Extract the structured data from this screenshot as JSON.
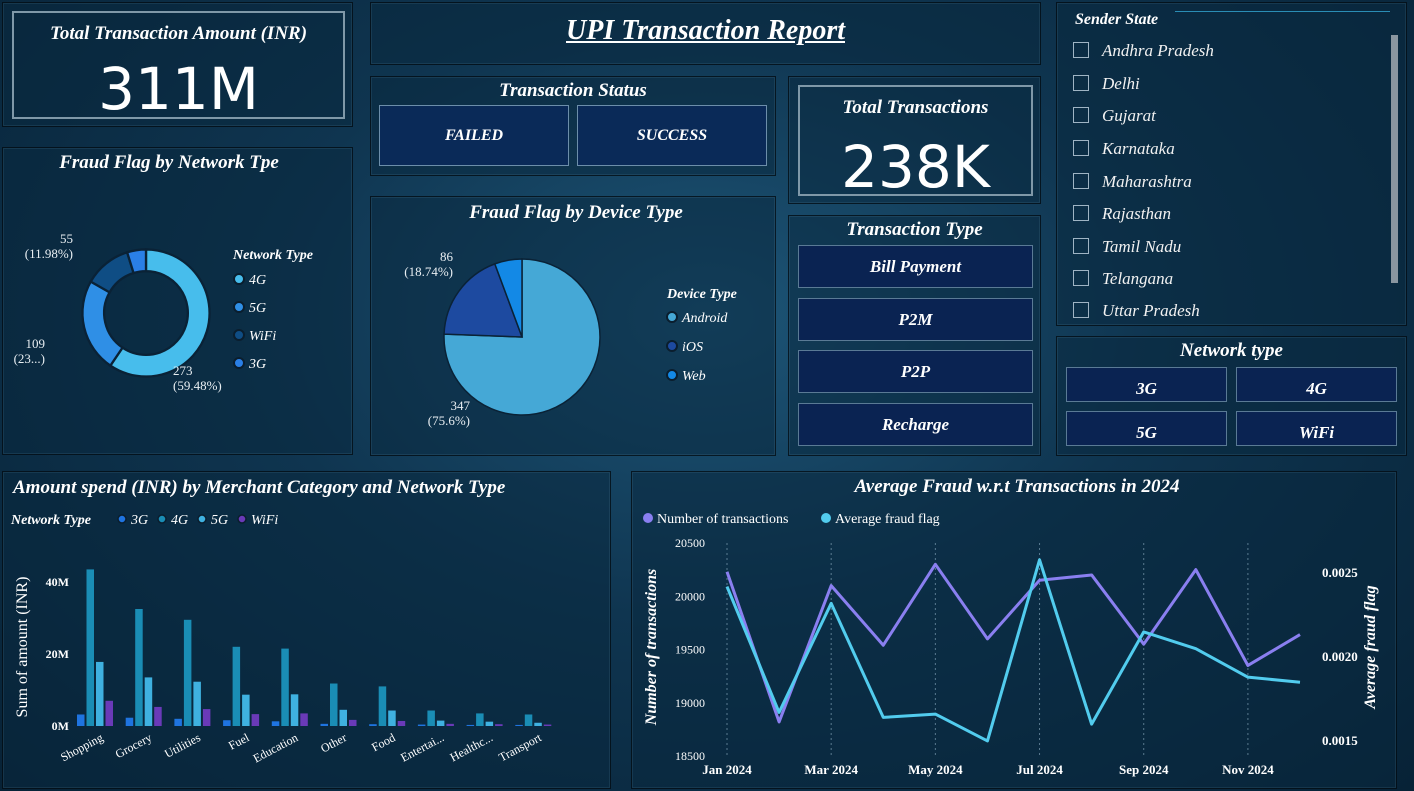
{
  "kpi_amount": {
    "title": "Total Transaction Amount (INR)",
    "value": "311M"
  },
  "report_title": "UPI Transaction Report",
  "status": {
    "title": "Transaction Status",
    "buttons": [
      "FAILED",
      "SUCCESS"
    ]
  },
  "kpi_count": {
    "title": "Total Transactions",
    "value": "238K"
  },
  "sender_state": {
    "title": "Sender State",
    "items": [
      "Andhra Pradesh",
      "Delhi",
      "Gujarat",
      "Karnataka",
      "Maharashtra",
      "Rajasthan",
      "Tamil Nadu",
      "Telangana",
      "Uttar Pradesh"
    ]
  },
  "txn_type": {
    "title": "Transaction Type",
    "buttons": [
      "Bill Payment",
      "P2M",
      "P2P",
      "Recharge"
    ]
  },
  "network_slicer": {
    "title": "Network type",
    "buttons": [
      "3G",
      "4G",
      "5G",
      "WiFi"
    ]
  },
  "colors": {
    "g3": "#1f74e0",
    "g4": "#1a8db5",
    "g5": "#3fb1e0",
    "wifi": "#6a3ab8",
    "line_txn": "#8a7ff0",
    "line_fraud": "#52ccee"
  },
  "chart_data": [
    {
      "type": "pie",
      "variant": "donut",
      "title": "Fraud Flag by Network Tpe",
      "legend_title": "Network Type",
      "legend": [
        "4G",
        "5G",
        "WiFi",
        "3G"
      ],
      "slices": [
        {
          "name": "4G",
          "value": 273,
          "label1": "273",
          "label2": "(59.48%)",
          "color": "#47bdec"
        },
        {
          "name": "5G",
          "value": 109,
          "label1": "109",
          "label2": "(23...)",
          "color": "#2f8fe6"
        },
        {
          "name": "WiFi",
          "value": 55,
          "label1": "55",
          "label2": "(11.98%)",
          "color": "#0f4d84"
        },
        {
          "name": "3G",
          "value": 22,
          "label1": "",
          "label2": "",
          "color": "#2a7fe6"
        }
      ]
    },
    {
      "type": "pie",
      "title": "Fraud Flag by Device Type",
      "legend_title": "Device Type",
      "legend": [
        "Android",
        "iOS",
        "Web"
      ],
      "slices": [
        {
          "name": "Android",
          "value": 347,
          "label1": "347",
          "label2": "(75.6%)",
          "color": "#45a8d6"
        },
        {
          "name": "iOS",
          "value": 86,
          "label1": "86",
          "label2": "(18.74%)",
          "color": "#1d4aa0"
        },
        {
          "name": "Web",
          "value": 26,
          "label1": "",
          "label2": "",
          "color": "#1389e6"
        }
      ]
    },
    {
      "type": "bar",
      "title": "Amount spend (INR) by Merchant Category and Network Type",
      "legend_title": "Network Type",
      "ylabel": "Sum of amount (INR)",
      "yticks": [
        "0M",
        "20M",
        "40M"
      ],
      "ylim": [
        0,
        50
      ],
      "categories": [
        "Shopping",
        "Grocery",
        "Utilities",
        "Fuel",
        "Education",
        "Other",
        "Food",
        "Entertai...",
        "Healthc...",
        "Transport"
      ],
      "series": [
        {
          "name": "3G",
          "values": [
            3.2,
            2.3,
            2.0,
            1.6,
            1.3,
            0.6,
            0.5,
            0.4,
            0.3,
            0.3
          ]
        },
        {
          "name": "4G",
          "values": [
            43.5,
            32.5,
            29.5,
            22,
            21.5,
            11.8,
            11,
            4.3,
            3.5,
            3.2
          ]
        },
        {
          "name": "5G",
          "values": [
            17.8,
            13.5,
            12.3,
            8.7,
            8.8,
            4.5,
            4.3,
            1.5,
            1.2,
            0.9
          ]
        },
        {
          "name": "WiFi",
          "values": [
            7,
            5.3,
            4.7,
            3.3,
            3.5,
            1.7,
            1.4,
            0.6,
            0.5,
            0.4
          ]
        }
      ]
    },
    {
      "type": "line",
      "title": "Average Fraud w.r.t Transactions in 2024",
      "ylabel": "Number of transactions",
      "y2label": "Average fraud flag",
      "x": [
        "Jan 2024",
        "Feb 2024",
        "Mar 2024",
        "Apr 2024",
        "May 2024",
        "Jun 2024",
        "Jul 2024",
        "Aug 2024",
        "Sep 2024",
        "Oct 2024",
        "Nov 2024",
        "Dec 2024"
      ],
      "xticks": [
        "Jan 2024",
        "Mar 2024",
        "May 2024",
        "Jul 2024",
        "Sep 2024",
        "Nov 2024"
      ],
      "yticks": [
        "18500",
        "19000",
        "19500",
        "20000",
        "20500"
      ],
      "ylim": [
        18500,
        20500
      ],
      "y2ticks": [
        "0.0015",
        "0.0020",
        "0.0025"
      ],
      "y2lim": [
        0.00141,
        0.00268
      ],
      "series": [
        {
          "name": "Number of transactions",
          "axis": "left",
          "values": [
            20230,
            18820,
            20100,
            19540,
            20300,
            19600,
            20150,
            20200,
            19550,
            20250,
            19350,
            19640
          ]
        },
        {
          "name": "Average fraud flag",
          "axis": "right",
          "values": [
            0.00242,
            0.00167,
            0.00232,
            0.00164,
            0.00166,
            0.0015,
            0.00258,
            0.0016,
            0.00215,
            0.00205,
            0.00188,
            0.00185
          ]
        }
      ]
    }
  ]
}
